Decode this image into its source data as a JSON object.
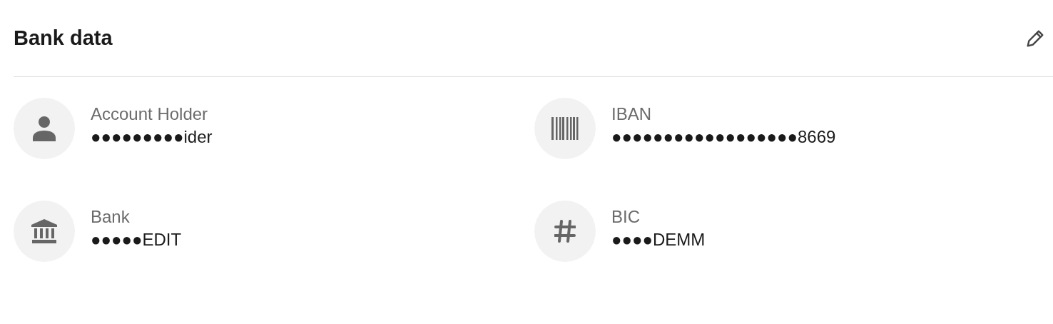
{
  "title": "Bank data",
  "fields": [
    {
      "kind": "person",
      "label": "Account Holder",
      "value": "●●●●●●●●●ider"
    },
    {
      "kind": "barcode",
      "label": "IBAN",
      "value": "●●●●●●●●●●●●●●●●●●8669"
    },
    {
      "kind": "bank",
      "label": "Bank",
      "value": "●●●●●EDIT"
    },
    {
      "kind": "hash",
      "label": "BIC",
      "value": "●●●●DEMM"
    }
  ]
}
